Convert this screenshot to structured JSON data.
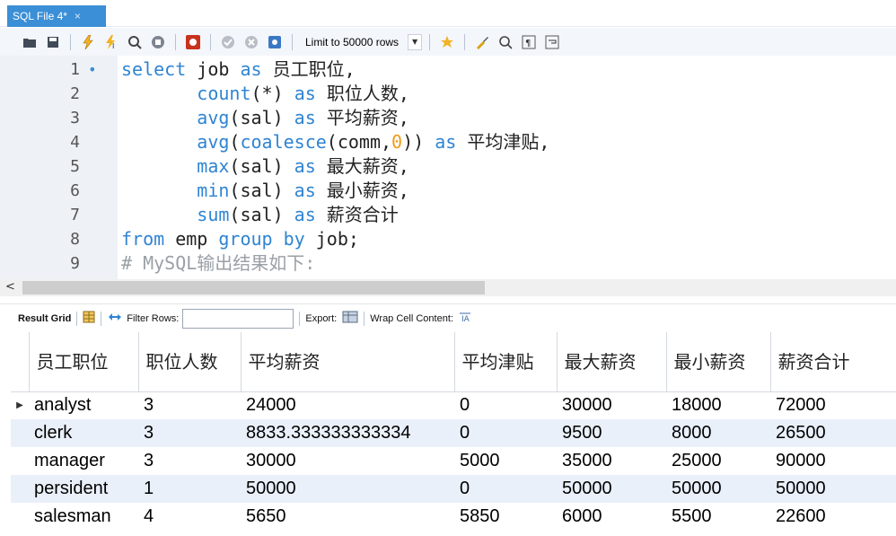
{
  "tab": {
    "title": "SQL File 4*",
    "close": "×"
  },
  "toolbar": {
    "limit_label": "Limit to 50000 rows"
  },
  "editor": {
    "lines": [
      {
        "n": "1",
        "parts": [
          [
            "kw",
            "select"
          ],
          [
            "t",
            " job "
          ],
          [
            "kw",
            "as"
          ],
          [
            "t",
            " 员工职位,"
          ]
        ]
      },
      {
        "n": "2",
        "parts": [
          [
            "t",
            "       "
          ],
          [
            "kw",
            "count"
          ],
          [
            "t",
            "(*) "
          ],
          [
            "kw",
            "as"
          ],
          [
            "t",
            " 职位人数,"
          ]
        ]
      },
      {
        "n": "3",
        "parts": [
          [
            "t",
            "       "
          ],
          [
            "kw",
            "avg"
          ],
          [
            "t",
            "(sal) "
          ],
          [
            "kw",
            "as"
          ],
          [
            "t",
            " 平均薪资,"
          ]
        ]
      },
      {
        "n": "4",
        "parts": [
          [
            "t",
            "       "
          ],
          [
            "kw",
            "avg"
          ],
          [
            "t",
            "("
          ],
          [
            "kw",
            "coalesce"
          ],
          [
            "t",
            "(comm,"
          ],
          [
            "num",
            "0"
          ],
          [
            "t",
            ")) "
          ],
          [
            "kw",
            "as"
          ],
          [
            "t",
            " 平均津贴,"
          ]
        ]
      },
      {
        "n": "5",
        "parts": [
          [
            "t",
            "       "
          ],
          [
            "kw",
            "max"
          ],
          [
            "t",
            "(sal) "
          ],
          [
            "kw",
            "as"
          ],
          [
            "t",
            " 最大薪资,"
          ]
        ]
      },
      {
        "n": "6",
        "parts": [
          [
            "t",
            "       "
          ],
          [
            "kw",
            "min"
          ],
          [
            "t",
            "(sal) "
          ],
          [
            "kw",
            "as"
          ],
          [
            "t",
            " 最小薪资,"
          ]
        ]
      },
      {
        "n": "7",
        "parts": [
          [
            "t",
            "       "
          ],
          [
            "kw",
            "sum"
          ],
          [
            "t",
            "(sal) "
          ],
          [
            "kw",
            "as"
          ],
          [
            "t",
            " 薪资合计"
          ]
        ]
      },
      {
        "n": "8",
        "parts": [
          [
            "kw",
            "from"
          ],
          [
            "t",
            " emp "
          ],
          [
            "kw",
            "group by"
          ],
          [
            "t",
            " job;"
          ]
        ]
      },
      {
        "n": "9",
        "parts": [
          [
            "cm",
            "# MySQL输出结果如下:"
          ]
        ]
      }
    ]
  },
  "result_toolbar": {
    "result_grid": "Result Grid",
    "filter_rows": "Filter Rows:",
    "export": "Export:",
    "wrap": "Wrap Cell Content:"
  },
  "grid": {
    "headers": [
      "员工职位",
      "职位人数",
      "平均薪资",
      "平均津贴",
      "最大薪资",
      "最小薪资",
      "薪资合计"
    ],
    "rows": [
      [
        "analyst",
        "3",
        "24000",
        "0",
        "30000",
        "18000",
        "72000"
      ],
      [
        "clerk",
        "3",
        "8833.333333333334",
        "0",
        "9500",
        "8000",
        "26500"
      ],
      [
        "manager",
        "3",
        "30000",
        "5000",
        "35000",
        "25000",
        "90000"
      ],
      [
        "persident",
        "1",
        "50000",
        "0",
        "50000",
        "50000",
        "50000"
      ],
      [
        "salesman",
        "4",
        "5650",
        "5850",
        "6000",
        "5500",
        "22600"
      ]
    ]
  },
  "colors": {
    "keyword": "#2f84d2",
    "number": "#f19a1a",
    "comment": "#9aa0a6",
    "tab": "#3b8fd6",
    "row_alt": "#eaf0fa"
  }
}
